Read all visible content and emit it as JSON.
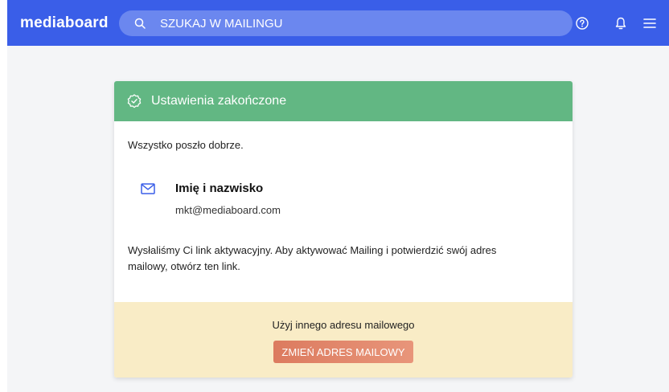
{
  "app": {
    "logo_text": "mediaboard"
  },
  "search": {
    "placeholder": "SZUKAJ W MAILINGU"
  },
  "topbar_icons": [
    "help-icon",
    "bell-icon",
    "menu-icon"
  ],
  "card": {
    "header_title": "Ustawienia zakończone",
    "intro": "Wszystko poszło dobrze.",
    "contact": {
      "name": "Imię i nazwisko",
      "email": "mkt@mediaboard.com"
    },
    "message": "Wysłaliśmy Ci link aktywacyjny. Aby aktywować Mailing i potwierdzić swój adres mailowy, otwórz ten link.",
    "footer": {
      "text": "Użyj innego adresu mailowego",
      "button_label": "ZMIEŃ ADRES MAILOWY"
    }
  },
  "colors": {
    "topbar": "#3a5ee8",
    "header_success": "#62b783",
    "footer_bg": "#f9ecc6",
    "button": "#dc7b5f"
  }
}
